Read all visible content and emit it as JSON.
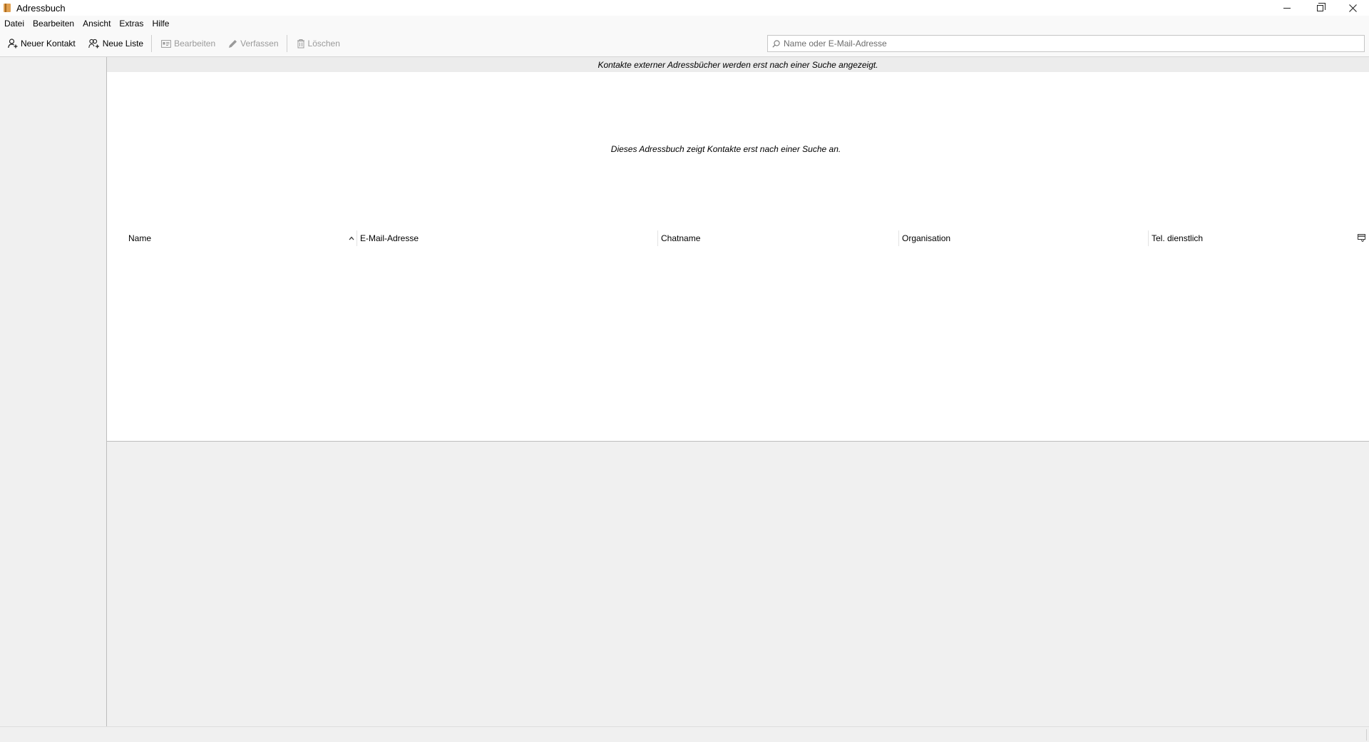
{
  "window": {
    "title": "Adressbuch",
    "app_icon": "address-book-icon"
  },
  "menu": {
    "items": [
      "Datei",
      "Bearbeiten",
      "Ansicht",
      "Extras",
      "Hilfe"
    ]
  },
  "toolbar": {
    "new_contact": "Neuer Kontakt",
    "new_list": "Neue Liste",
    "edit": "Bearbeiten",
    "compose": "Verfassen",
    "delete": "Löschen",
    "search_placeholder": "Name oder E-Mail-Adresse",
    "search_value": ""
  },
  "notice": {
    "text": "Kontakte externer Adressbücher werden erst nach einer Suche angezeigt."
  },
  "results": {
    "empty_message": "Dieses Adressbuch zeigt Kontakte erst nach einer Suche an.",
    "columns": [
      "Name",
      "E-Mail-Adresse",
      "Chatname",
      "Organisation",
      "Tel. dienstlich"
    ],
    "sort_column": "Name",
    "sort_direction": "ascending",
    "rows": []
  },
  "colors": {
    "titlebar": "#ffffff",
    "toolbar": "#f9f9f9",
    "panel": "#f0f0f0",
    "disabled_text": "#9a9a9a"
  }
}
